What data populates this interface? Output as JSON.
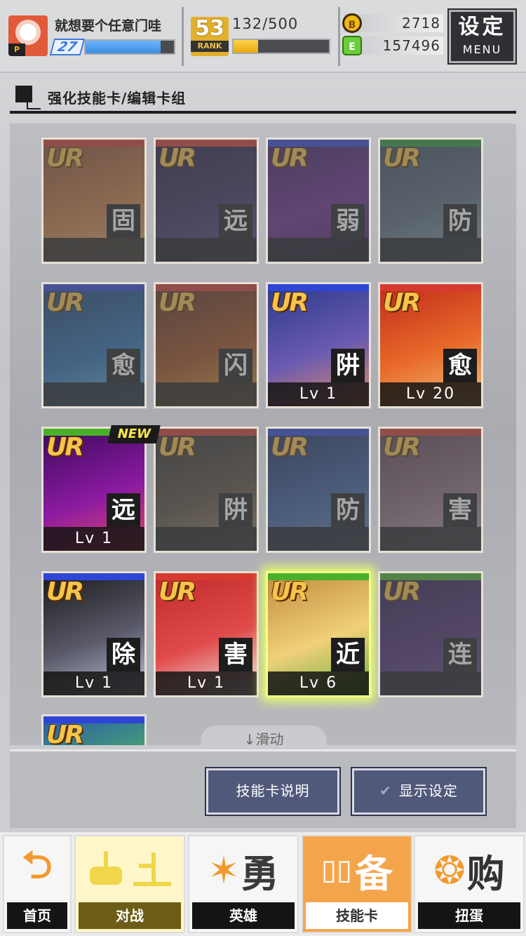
{
  "player": {
    "name": "就想要个任意门哇",
    "level": "27",
    "exp_fraction": 0.85,
    "avatar_tag": "P"
  },
  "rank": {
    "value": "53",
    "label": "RANK"
  },
  "stamina": {
    "text": "132/500",
    "fraction": 0.26
  },
  "currency": {
    "coin_icon": "B",
    "coin": "2718",
    "gem_icon": "E",
    "gem": "157496"
  },
  "menu": {
    "title": "设定",
    "subtitle": "MENU"
  },
  "header": {
    "title": "强化技能卡/编辑卡组"
  },
  "cards": [
    {
      "rarity": "UR",
      "type": "固",
      "level": "",
      "locked": true,
      "bar": "#d63a2f",
      "art": [
        "#8a4a2a",
        "#c7773f",
        "#e0b070"
      ]
    },
    {
      "rarity": "UR",
      "type": "远",
      "level": "",
      "locked": true,
      "bar": "#d63a2f",
      "art": [
        "#1c1a3a",
        "#3a2d5c",
        "#5a4a80"
      ]
    },
    {
      "rarity": "UR",
      "type": "弱",
      "level": "",
      "locked": true,
      "bar": "#2f45d6",
      "art": [
        "#3a1a5a",
        "#6a2a8a",
        "#4a1a60"
      ]
    },
    {
      "rarity": "UR",
      "type": "防",
      "level": "",
      "locked": true,
      "bar": "#2f9a3a",
      "art": [
        "#3a4a5a",
        "#5a6a7a",
        "#8aa0b0"
      ]
    },
    {
      "rarity": "UR",
      "type": "愈",
      "level": "",
      "locked": true,
      "bar": "#2f45d6",
      "art": [
        "#1a3a6a",
        "#2a6aaa",
        "#6ab0e0"
      ]
    },
    {
      "rarity": "UR",
      "type": "闪",
      "level": "",
      "locked": true,
      "bar": "#d63a2f",
      "art": [
        "#5a2a1a",
        "#a04a1a",
        "#e0a030"
      ]
    },
    {
      "rarity": "UR",
      "type": "阱",
      "level": "Lv 1",
      "locked": false,
      "bar": "#2f45d6",
      "art": [
        "#2a3a8a",
        "#6a5ab0",
        "#e08a6a"
      ]
    },
    {
      "rarity": "UR",
      "type": "愈",
      "level": "Lv 20",
      "locked": false,
      "bar": "#d63a2f",
      "art": [
        "#c02a1a",
        "#e86a2a",
        "#f0c07a"
      ]
    },
    {
      "rarity": "UR",
      "type": "远",
      "level": "Lv 1",
      "locked": false,
      "bar": "#4ab02a",
      "art": [
        "#3a0a5a",
        "#8a1aa0",
        "#e04a6a"
      ]
    },
    {
      "rarity": "UR",
      "type": "阱",
      "level": "",
      "locked": true,
      "bar": "#d63a2f",
      "art": [
        "#2a2a2a",
        "#5a4a3a",
        "#a08a6a"
      ]
    },
    {
      "rarity": "UR",
      "type": "防",
      "level": "",
      "locked": true,
      "bar": "#2f45d6",
      "art": [
        "#1a2a5a",
        "#3a5a9a",
        "#6a8ab0"
      ]
    },
    {
      "rarity": "UR",
      "type": "害",
      "level": "",
      "locked": true,
      "bar": "#d63a2f",
      "art": [
        "#5a3a4a",
        "#8a6a7a",
        "#c0a0b0"
      ]
    },
    {
      "rarity": "UR",
      "type": "除",
      "level": "Lv 1",
      "locked": false,
      "bar": "#2f45d6",
      "art": [
        "#1a1a1a",
        "#5a5a6a",
        "#c0c8d8"
      ]
    },
    {
      "rarity": "UR",
      "type": "害",
      "level": "Lv 1",
      "locked": false,
      "bar": "#d63a2f",
      "art": [
        "#c02a2a",
        "#e04a4a",
        "#f0f0f0"
      ]
    },
    {
      "rarity": "UR",
      "type": "近",
      "level": "Lv 6",
      "locked": false,
      "selected": true,
      "bar": "#4ab02a",
      "art": [
        "#c08a3a",
        "#f0d07a",
        "#6ab03a"
      ]
    },
    {
      "rarity": "UR",
      "type": "连",
      "level": "",
      "locked": true,
      "bar": "#4ab02a",
      "art": [
        "#2a1a4a",
        "#4a2a6a",
        "#6a4a8a"
      ]
    },
    {
      "rarity": "UR",
      "type": "",
      "level": "",
      "locked": false,
      "bar": "#2f45d6",
      "art": [
        "#2a5aaa",
        "#4ab06a",
        "#f0d040"
      ]
    }
  ],
  "new_badge": "NEW",
  "scroll_hint": "↓滑动",
  "buttons": {
    "skill_desc": "技能卡说明",
    "display_check": "✔",
    "display_settings": "显示设定"
  },
  "nav": {
    "home": {
      "icon": "⮌",
      "label": "首页"
    },
    "battle": {
      "icon": "🎮",
      "label": "对战"
    },
    "hero": {
      "icon_glyph": "勇",
      "label": "英雄"
    },
    "skill": {
      "icon_glyph": "备",
      "label": "技能卡"
    },
    "gacha": {
      "icon_glyph": "购",
      "label": "扭蛋"
    }
  },
  "colors": {
    "accent": "#f29a2e",
    "exp": "#3b8de0",
    "stamina": "#e8a90f",
    "button": "#51597b"
  }
}
